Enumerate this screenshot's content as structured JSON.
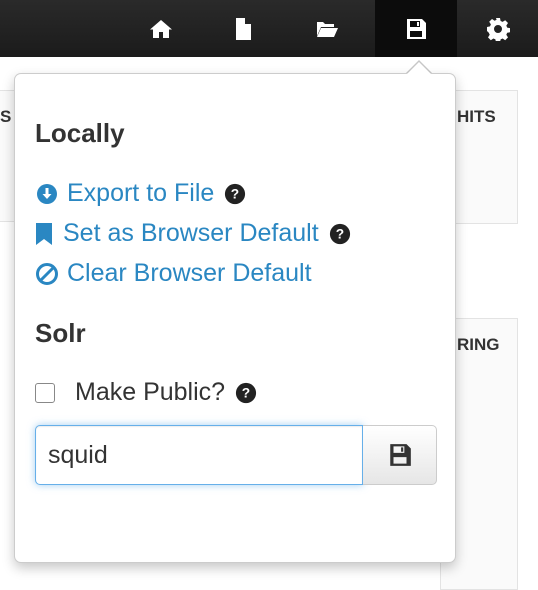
{
  "colors": {
    "navbar": "#222222",
    "link": "#2a87c2",
    "text": "#333333"
  },
  "navbar": {
    "items": [
      {
        "name": "home-icon"
      },
      {
        "name": "file-icon"
      },
      {
        "name": "folder-open-icon"
      },
      {
        "name": "floppy-disk-icon",
        "active": true
      },
      {
        "name": "gear-icon"
      }
    ]
  },
  "background": {
    "header_left": "S",
    "header_hits": "HITS",
    "header_ring": "RING"
  },
  "popover": {
    "locally_title": "Locally",
    "export_label": "Export to File",
    "set_default_label": "Set as Browser Default",
    "clear_default_label": "Clear Browser Default",
    "solr_title": "Solr",
    "make_public_label": "Make Public?",
    "name_input_value": "squid"
  }
}
